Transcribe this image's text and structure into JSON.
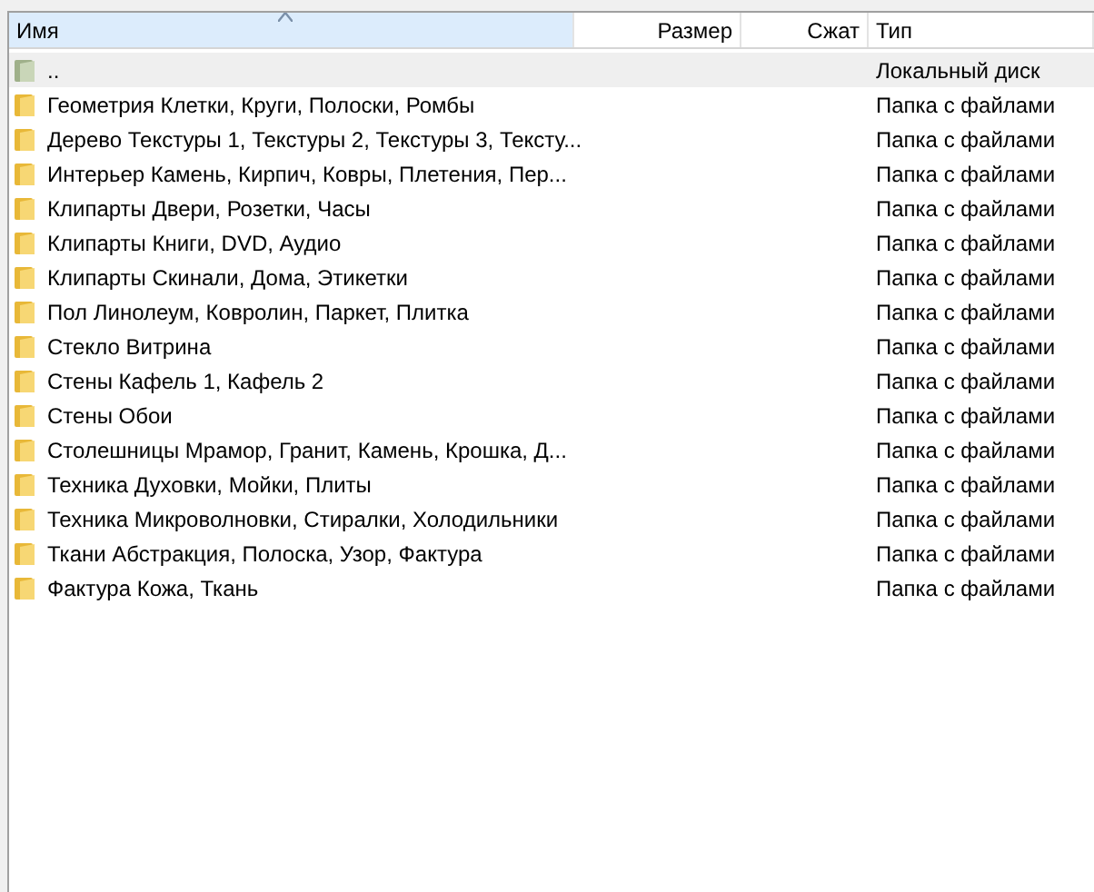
{
  "table": {
    "columns": [
      {
        "label": "Имя",
        "sorted": true
      },
      {
        "label": "Размер",
        "sorted": false
      },
      {
        "label": "Сжат",
        "sorted": false
      },
      {
        "label": "Тип",
        "sorted": false
      }
    ],
    "rows": [
      {
        "kind": "parent",
        "name": "..",
        "type": "Локальный диск",
        "selected": true
      },
      {
        "kind": "folder",
        "name": "Геометрия Клетки, Круги, Полоски, Ромбы",
        "type": "Папка с файлами",
        "selected": false
      },
      {
        "kind": "folder",
        "name": "Дерево Текстуры 1, Текстуры 2, Текстуры 3, Тексту...",
        "type": "Папка с файлами",
        "selected": false
      },
      {
        "kind": "folder",
        "name": "Интерьер Камень, Кирпич, Ковры, Плетения, Пер...",
        "type": "Папка с файлами",
        "selected": false
      },
      {
        "kind": "folder",
        "name": "Клипарты Двери, Розетки, Часы",
        "type": "Папка с файлами",
        "selected": false
      },
      {
        "kind": "folder",
        "name": "Клипарты Книги, DVD, Аудио",
        "type": "Папка с файлами",
        "selected": false
      },
      {
        "kind": "folder",
        "name": "Клипарты Скинали, Дома, Этикетки",
        "type": "Папка с файлами",
        "selected": false
      },
      {
        "kind": "folder",
        "name": "Пол Линолеум, Ковролин, Паркет, Плитка",
        "type": "Папка с файлами",
        "selected": false
      },
      {
        "kind": "folder",
        "name": "Стекло Витрина",
        "type": "Папка с файлами",
        "selected": false
      },
      {
        "kind": "folder",
        "name": "Стены Кафель 1, Кафель 2",
        "type": "Папка с файлами",
        "selected": false
      },
      {
        "kind": "folder",
        "name": "Стены Обои",
        "type": "Папка с файлами",
        "selected": false
      },
      {
        "kind": "folder",
        "name": "Столешницы Мрамор, Гранит, Камень, Крошка, Д...",
        "type": "Папка с файлами",
        "selected": false
      },
      {
        "kind": "folder",
        "name": "Техника Духовки, Мойки, Плиты",
        "type": "Папка с файлами",
        "selected": false
      },
      {
        "kind": "folder",
        "name": "Техника Микроволновки, Стиралки, Холодильники",
        "type": "Папка с файлами",
        "selected": false
      },
      {
        "kind": "folder",
        "name": "Ткани Абстракция, Полоска, Узор, Фактура",
        "type": "Папка с файлами",
        "selected": false
      },
      {
        "kind": "folder",
        "name": "Фактура Кожа, Ткань",
        "type": "Папка с файлами",
        "selected": false
      }
    ]
  }
}
